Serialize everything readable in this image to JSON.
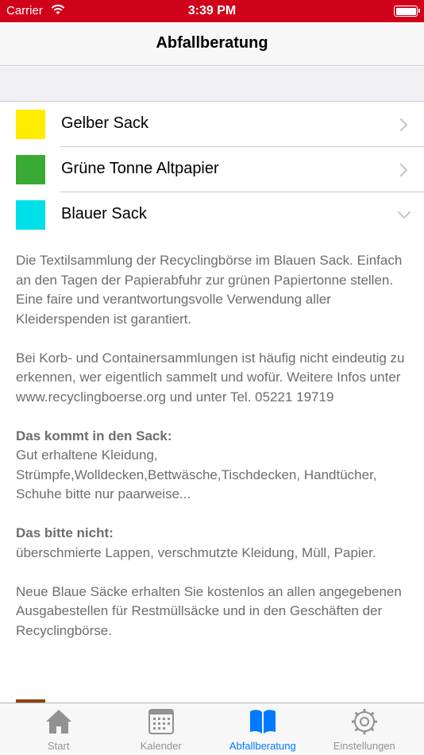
{
  "status_bar": {
    "carrier": "Carrier",
    "time": "3:39 PM"
  },
  "nav": {
    "title": "Abfallberatung"
  },
  "categories": [
    {
      "label": "Gelber Sack",
      "color": "#ffec00",
      "expanded": false
    },
    {
      "label": "Grüne Tonne Altpapier",
      "color": "#3aaa35",
      "expanded": false
    },
    {
      "label": "Blauer Sack",
      "color": "#00e0e8",
      "expanded": true
    }
  ],
  "detail": {
    "p1": "Die Textilsammlung der Recyclingbörse im Blauen Sack. Einfach an den Tagen der Papierabfuhr zur grünen Papiertonne stellen. Eine faire und verantwortungsvolle Verwendung aller Kleiderspenden ist garantiert.",
    "p2": "Bei Korb- und Containersammlungen ist häufig nicht eindeutig zu erkennen, wer eigentlich sammelt und wofür. Weitere Infos unter www.recyclingboerse.org und unter Tel. 05221 19719",
    "yes_heading": "Das kommt in den Sack:",
    "yes_text": "Gut erhaltene Kleidung, Strümpfe,Wolldecken,Bettwäsche,Tischdecken, Handtücher, Schuhe bitte nur paarweise...",
    "no_heading": "Das bitte nicht:",
    "no_text": "überschmierte Lappen, verschmutzte Kleidung, Müll, Papier.",
    "p5": "Neue Blaue Säcke erhalten Sie kostenlos an allen angegebenen Ausgabestellen für Restmüllsäcke und in den Geschäften der Recyclingbörse."
  },
  "tabs": [
    {
      "label": "Start",
      "icon": "home-icon",
      "active": false
    },
    {
      "label": "Kalender",
      "icon": "calendar-icon",
      "active": false
    },
    {
      "label": "Abfallberatung",
      "icon": "book-icon",
      "active": true
    },
    {
      "label": "Einstellungen",
      "icon": "gear-icon",
      "active": false
    }
  ],
  "colors": {
    "status_bar": "#d0021b",
    "accent": "#007aff",
    "inactive_tab": "#929292"
  }
}
